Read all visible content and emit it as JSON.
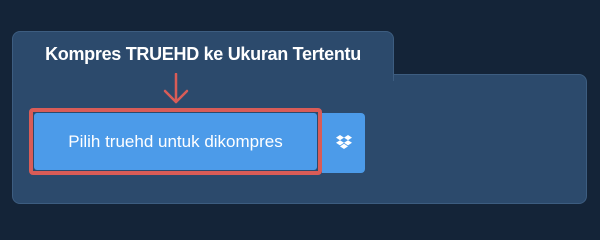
{
  "panel": {
    "title": "Kompres TRUEHD ke Ukuran Tertentu"
  },
  "upload": {
    "choose_label": "Pilih truehd untuk dikompres",
    "dropbox_icon": "dropbox-icon"
  },
  "colors": {
    "page_bg": "#142438",
    "panel_bg": "#2c4a6c",
    "button_bg": "#4c9be9",
    "highlight": "#d95c57"
  }
}
